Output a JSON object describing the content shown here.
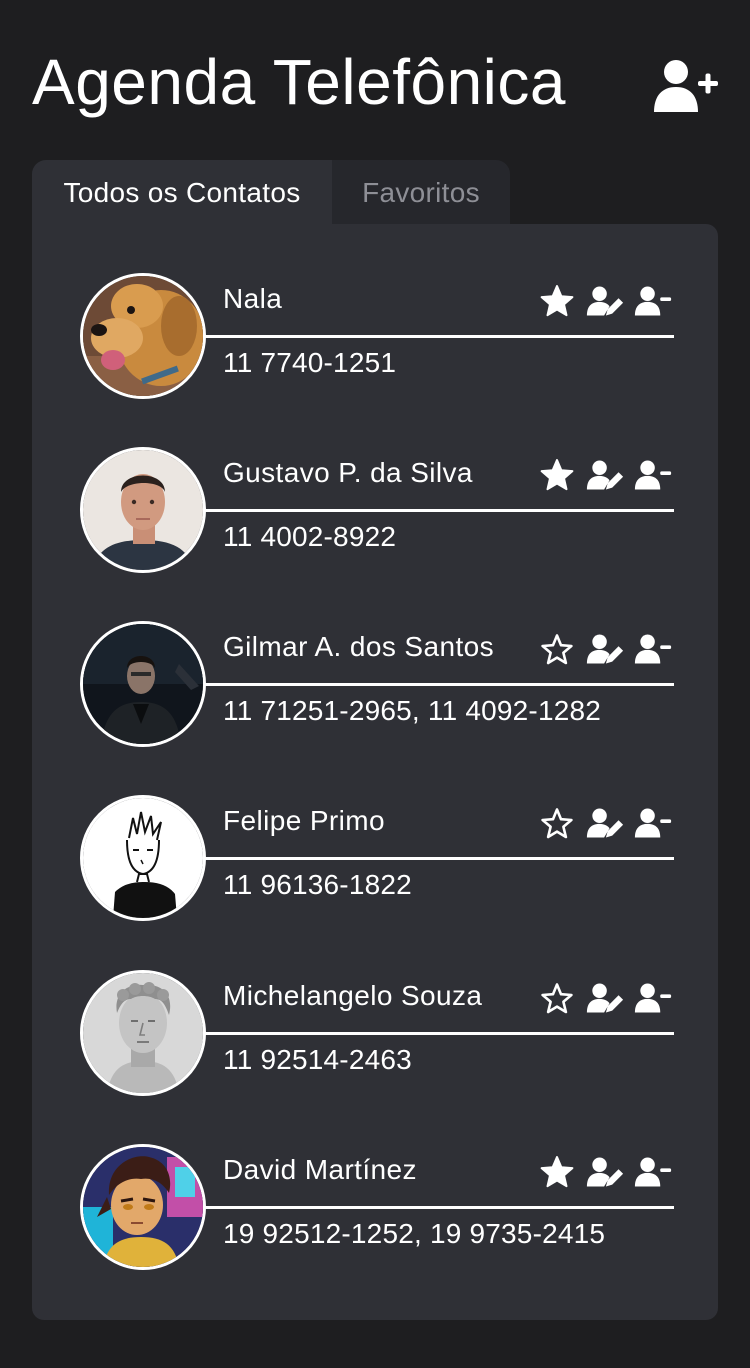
{
  "header": {
    "title": "Agenda Telefônica",
    "add_contact_icon": "user-plus-icon"
  },
  "tabs": [
    {
      "label": "Todos os Contatos",
      "active": true
    },
    {
      "label": "Favoritos",
      "active": false
    }
  ],
  "colors": {
    "background": "#1e1e20",
    "panel": "#2f3036",
    "inactive_tab": "#26272c",
    "inactive_tab_text": "#8e8f96",
    "foreground": "#ffffff"
  },
  "contacts": [
    {
      "name": "Nala",
      "phones": "11 7740-1251",
      "favorite": true,
      "avatar": "golden-retriever-photo"
    },
    {
      "name": "Gustavo P. da Silva",
      "phones": "11 4002-8922",
      "favorite": true,
      "avatar": "young-man-photo"
    },
    {
      "name": "Gilmar A. dos Santos",
      "phones": "11 71251-2965, 11 4092-1282",
      "favorite": false,
      "avatar": "man-in-suit-dark-photo"
    },
    {
      "name": "Felipe Primo",
      "phones": "11 96136-1822",
      "favorite": false,
      "avatar": "manga-sketch-drawing"
    },
    {
      "name": "Michelangelo Souza",
      "phones": "11 92514-2463",
      "favorite": false,
      "avatar": "david-statue-photo"
    },
    {
      "name": "David Martínez",
      "phones": "19 92512-1252, 19 9735-2415",
      "favorite": true,
      "avatar": "anime-character-drawing"
    }
  ],
  "action_icons": [
    "star-icon",
    "user-edit-icon",
    "user-minus-icon"
  ]
}
